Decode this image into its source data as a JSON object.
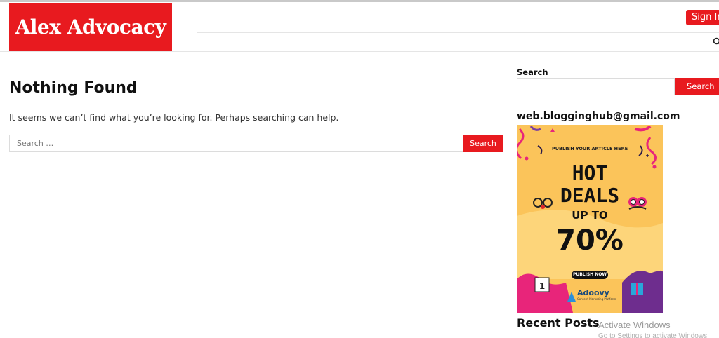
{
  "site": {
    "logo_text": "Alex Advocacy",
    "signin_label": "Sign In"
  },
  "header": {
    "search_toggle_icon": "search-icon"
  },
  "main": {
    "title": "Nothing Found",
    "message": "It seems we can’t find what you’re looking for. Perhaps searching can help.",
    "search": {
      "placeholder": "Search …",
      "button_label": "Search"
    }
  },
  "sidebar": {
    "search_label": "Search",
    "search_button_label": "Search",
    "email": "web.blogginghub@gmail.com",
    "ad": {
      "top_text": "PUBLISH YOUR ARTICLE HERE",
      "line1": "HOT",
      "line2": "DEALS",
      "line3": "UP TO",
      "line4": "70%",
      "cta": "PUBLISH NOW",
      "brand": "Adoovy",
      "brand_sub": "Content Marketing Platform"
    },
    "recent_posts_heading": "Recent Posts"
  },
  "watermark": {
    "line1": "Activate Windows",
    "line2": "Go to Settings to activate Windows."
  },
  "colors": {
    "brand_red": "#e81a1f",
    "ad_background": "#fbc45a"
  }
}
